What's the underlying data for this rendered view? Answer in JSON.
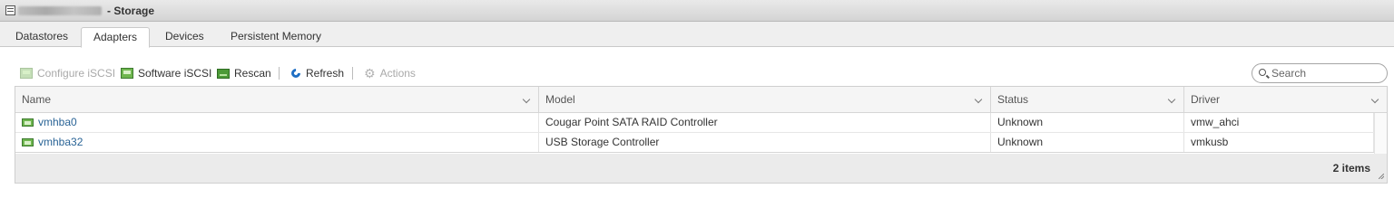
{
  "window": {
    "icon": "window-icon",
    "title_suffix": "- Storage"
  },
  "tabs": [
    {
      "label": "Datastores",
      "active": false
    },
    {
      "label": "Adapters",
      "active": true
    },
    {
      "label": "Devices",
      "active": false
    },
    {
      "label": "Persistent Memory",
      "active": false
    }
  ],
  "toolbar": {
    "configure_iscsi": {
      "label": "Configure iSCSI",
      "enabled": false,
      "icon": "iscsi-icon"
    },
    "software_iscsi": {
      "label": "Software iSCSI",
      "enabled": true,
      "icon": "iscsi-icon"
    },
    "rescan": {
      "label": "Rescan",
      "enabled": true,
      "icon": "rescan-icon"
    },
    "refresh": {
      "label": "Refresh",
      "enabled": true,
      "icon": "refresh-icon"
    },
    "actions": {
      "label": "Actions",
      "enabled": false,
      "icon": "gear-icon"
    }
  },
  "search": {
    "placeholder": "Search",
    "value": ""
  },
  "table": {
    "columns": [
      "Name",
      "Model",
      "Status",
      "Driver"
    ],
    "rows": [
      {
        "name": "vmhba0",
        "model": "Cougar Point SATA RAID Controller",
        "status": "Unknown",
        "driver": "vmw_ahci"
      },
      {
        "name": "vmhba32",
        "model": "USB Storage Controller",
        "status": "Unknown",
        "driver": "vmkusb"
      }
    ],
    "footer_count": "2 items"
  },
  "colors": {
    "link": "#2a6496",
    "active_tab_bg": "#ffffff",
    "tabbar_bg": "#efefef",
    "adapter_icon": "#6fb64f",
    "refresh_icon": "#1f6fc4"
  }
}
